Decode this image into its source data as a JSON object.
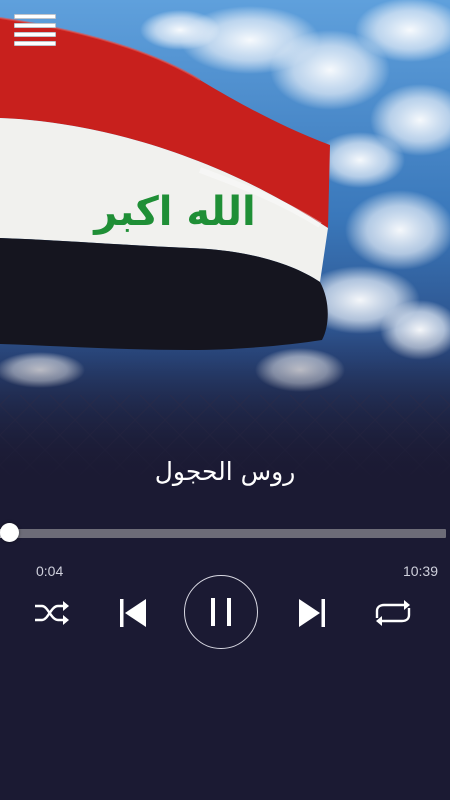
{
  "menu": {
    "icon": "hamburger-menu-icon"
  },
  "track": {
    "title": "روس الحجول",
    "elapsed": "0:04",
    "duration": "10:39",
    "progress_fraction": 0.006
  },
  "controls": {
    "shuffle_icon": "shuffle-icon",
    "previous_icon": "skip-previous-icon",
    "play_pause_icon": "pause-icon",
    "next_icon": "skip-next-icon",
    "repeat_icon": "repeat-icon"
  },
  "flag": {
    "text": "الله اكبر"
  },
  "colors": {
    "background": "#1b1a33",
    "flag_red": "#c8201d",
    "flag_white": "#f1f1ee",
    "flag_black": "#15151f",
    "flag_green": "#1f8f36",
    "sky_blue": "#3d7fc0"
  }
}
